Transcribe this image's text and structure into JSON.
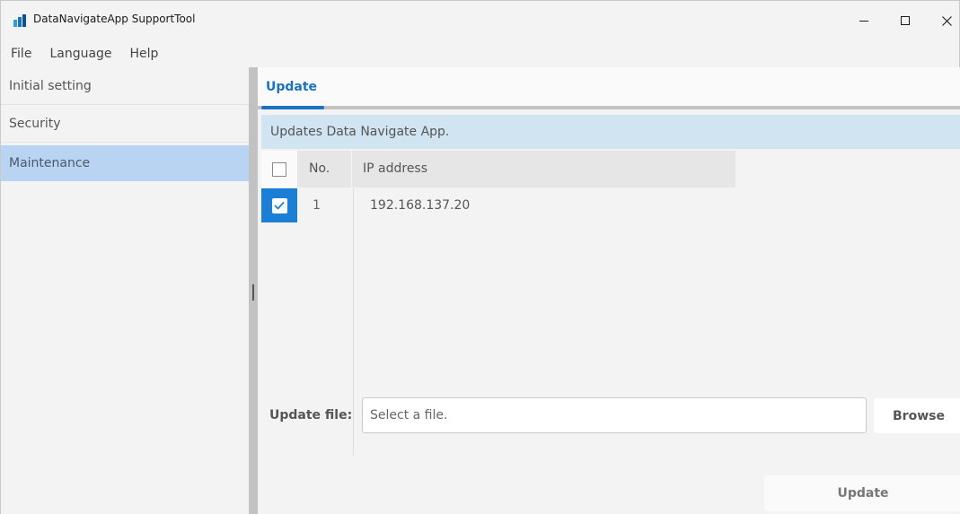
{
  "window": {
    "title": "DataNavigateApp SupportTool",
    "brand_color": "#1b72c2"
  },
  "menu": {
    "items": [
      {
        "label": "File"
      },
      {
        "label": "Language"
      },
      {
        "label": "Help"
      }
    ]
  },
  "sidebar": {
    "items": [
      {
        "label": "Initial setting"
      },
      {
        "label": "Security"
      },
      {
        "label": "Maintenance",
        "selected": true
      }
    ]
  },
  "main": {
    "tab": {
      "label": "Update"
    },
    "info_text": "Updates Data Navigate App.",
    "table": {
      "headers": {
        "no": "No.",
        "ip": "IP address"
      },
      "header_checked": false,
      "rows": [
        {
          "checked": true,
          "no": "1",
          "ip": "192.168.137.20"
        }
      ]
    },
    "update_file": {
      "label": "Update file:",
      "value": "",
      "placeholder": "Select a file."
    },
    "browse_label": "Browse",
    "update_label": "Update"
  },
  "icons": {
    "app": "app-logo-icon",
    "minimize": "minimize-icon",
    "maximize": "maximize-icon",
    "close": "close-icon",
    "check": "checkmark-icon"
  }
}
